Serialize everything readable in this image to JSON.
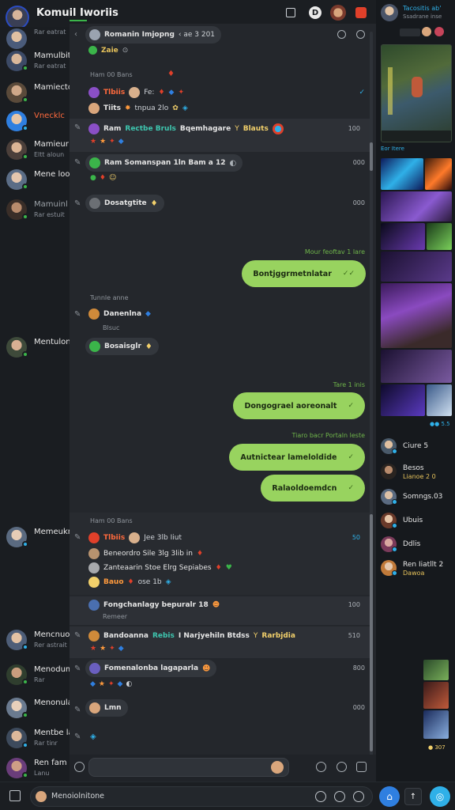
{
  "colors": {
    "accent_green": "#98d35f",
    "online": "#3bb54a",
    "blue_button": "#2f7fe0",
    "background": "#16191d",
    "chat_panel": "#24272c"
  },
  "topbar": {
    "title": "Komuil Iworiis",
    "icons": [
      "layout-icon",
      "status-icon",
      "avatar-icon",
      "bell-icon"
    ]
  },
  "left_list": [
    {
      "name": "Mamulbit",
      "sub": "Rar eatrat"
    },
    {
      "name": "Mamiectc",
      "sub": ""
    },
    {
      "name": "Vnecklc",
      "sub": ""
    },
    {
      "name": "Mamieur",
      "sub": "Eltt aloun"
    },
    {
      "name": "Mene loo",
      "sub": ""
    },
    {
      "name": "Mamuinl",
      "sub": "Rar estuit"
    },
    {
      "name": "Mentulon",
      "sub": ""
    },
    {
      "name": "Memeuknb",
      "sub": ""
    },
    {
      "name": "Mencnuol",
      "sub": "Rer astrait"
    },
    {
      "name": "Menodum",
      "sub": "Rar"
    },
    {
      "name": "Menonulam",
      "sub": ""
    },
    {
      "name": "Mentbe lar",
      "sub": "Rar tinr"
    },
    {
      "name": "Ren fam",
      "sub": "Lanu"
    }
  ],
  "chat": {
    "top_thread_label": "Romanin Imjopng",
    "top_thread_meta": "‹ ae 3 201",
    "top_thread_sub": "Zaie",
    "section1_label": "Ham 00 Bans",
    "line1": "Tlbiis",
    "line1b": "Fe: ",
    "line2": "Tiits",
    "line2b": "tnpua 2lo",
    "msg1": {
      "name": "Ram",
      "accent": "Rectbe Bruls",
      "text": "Bqemhagare",
      "tail": "Blauts",
      "time": "100"
    },
    "msg2": {
      "text": "Ram Somanspan 1ln Bam a 12",
      "time": "000"
    },
    "msg3": {
      "text": "Dosatgtite",
      "time": "000"
    },
    "sent1_label": "Mour feoftav 1 lare",
    "bubble1": "Bontjggrmetnlatar",
    "section2_label": "Tunnle anne",
    "msg4": "Danenlna",
    "msg4_sub": "Blsuc",
    "msg5": "Bosaisglr",
    "sent2_label": "Tare 1 inis",
    "bubble2": "Dongograel aoreonalt",
    "sent3_label": "Tiaro bacr Portaln leste",
    "bubble3": "Autnictear lameloldide",
    "bubble4": "Ralaoldoemdcn",
    "section3_label": "Ham 00 Bans",
    "thread2_l1": "Tlbiis",
    "thread2_l1b": "Jee 3lb Iiut",
    "thread2_time": "50",
    "thread2_l2": "Beneordro Sile 3lg 3lib in",
    "thread2_l3": "Zanteaarin Stoe Elrg Sepiabes",
    "thread2_l4": "Bauo",
    "thread2_l4b": "ose 1b",
    "msg6": {
      "text": "Fongchanlagy bepuralr 18",
      "sub": "Remeer",
      "time": "100"
    },
    "msg7": {
      "name": "Bandoanna",
      "accent": "Rebis",
      "text": "I Narjyehiln Btdss",
      "tail": "Rarbjdia",
      "time": "510"
    },
    "msg8": {
      "text": "Fomenalonba lagaparla",
      "time": "800"
    },
    "msg9": {
      "text": "Lmn",
      "time": "000"
    }
  },
  "composer": {
    "icons": [
      "attach-icon",
      "sticker-icon",
      "gif-icon",
      "send-icon"
    ]
  },
  "right_panel": {
    "header_title": "Tacositis ab'",
    "header_sub": "Ssadrane inse",
    "stream_meta": "Eor Itere",
    "stream_count": "●● 5.5",
    "contacts": [
      {
        "name": "Ciure 5",
        "sub": ""
      },
      {
        "name": "Besos",
        "sub": "Lianoe 2 0"
      },
      {
        "name": "Somngs.03",
        "sub": ""
      },
      {
        "name": "Ubuis",
        "sub": ""
      },
      {
        "name": "Ddlis",
        "sub": ""
      },
      {
        "name": "Ren Iiatllt 2",
        "sub": "Dawoa"
      }
    ],
    "bottom_label": "● 307"
  },
  "bottombar": {
    "search_text": "Menoiolnitone"
  }
}
